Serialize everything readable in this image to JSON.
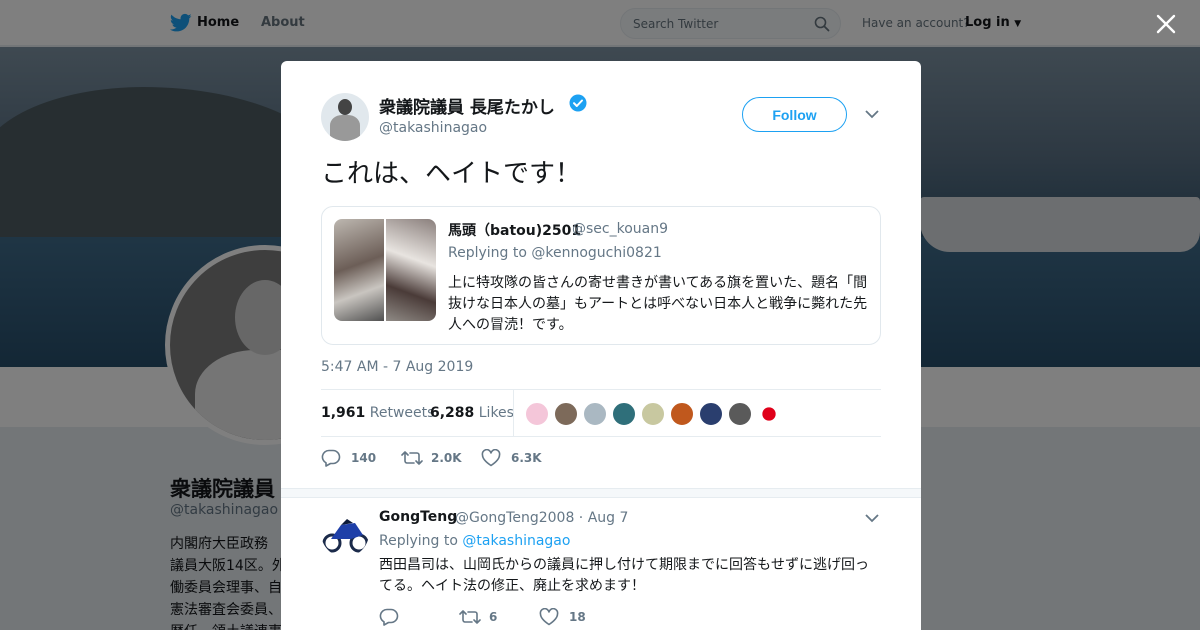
{
  "nav": {
    "home_label": "Home",
    "about_label": "About",
    "search_placeholder": "Search Twitter",
    "account_prompt": "Have an account?",
    "login_label": "Log in"
  },
  "profile": {
    "name": "衆議院議員",
    "handle": "@takashinagao",
    "bio_lines": [
      "内閣府大臣政務",
      "議員大阪14区。外",
      "働委員会理事、自",
      "憲法審査会委員、",
      "歴任。領土議連事"
    ]
  },
  "tweet": {
    "author_name": "衆議院議員 長尾たかし",
    "author_handle": "@takashinagao",
    "follow_label": "Follow",
    "text": "これは、ヘイトです！",
    "quote": {
      "name": "馬頭（batou)2501",
      "handle": "@sec_kouan9",
      "replying_to": "Replying to @kennoguchi0821",
      "text": "上に特攻隊の皆さんの寄せ書きが書いてある旗を置いた、題名「間抜けな日本人の墓」もアートとは呼べない日本人と戦争に斃れた先人への冒涜！です。"
    },
    "timestamp": "5:47 AM - 7 Aug 2019",
    "retweets_count": "1,961",
    "retweets_label": "Retweets",
    "likes_count": "6,288",
    "likes_label": "Likes",
    "liker_colors": [
      "#f4c6d9",
      "#7d6a5a",
      "#aab8c2",
      "#2f6f7a",
      "#c8c8a0",
      "#c0581d",
      "#2a3e6e",
      "#5a5a5a",
      "#e0001a"
    ],
    "actions": {
      "reply_count": "140",
      "retweet_count": "2.0K",
      "like_count": "6.3K"
    }
  },
  "reply": {
    "name": "GongTeng",
    "handle": "@GongTeng2008 · Aug 7",
    "replying_prefix": "Replying to",
    "replying_handle": "@takashinagao",
    "text": "西田昌司は、山岡氏からの議員に押し付けて期限までに回答もせずに逃げ回ってる。ヘイト法の修正、廃止を求めます！",
    "actions": {
      "reply_count": "",
      "retweet_count": "6",
      "like_count": "18"
    }
  },
  "colors": {
    "accent": "#1da1f2",
    "secondary_text": "#657786"
  }
}
